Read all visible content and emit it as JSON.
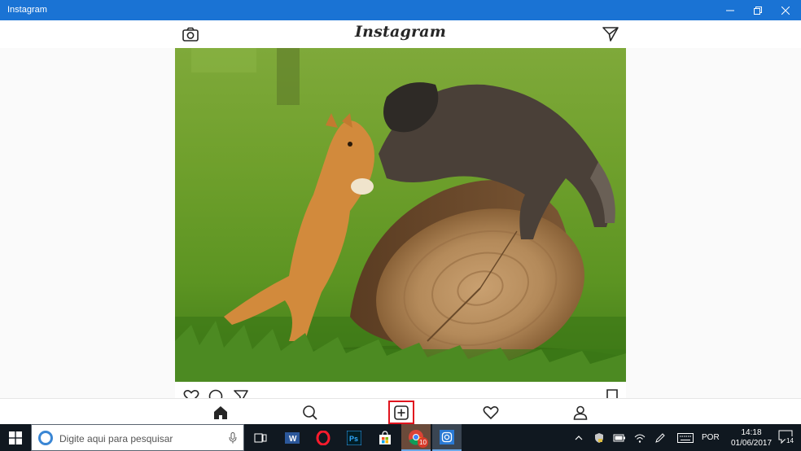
{
  "window": {
    "title": "Instagram"
  },
  "app": {
    "logo": "Instagram",
    "accent": "#1a73d4",
    "highlight": "#e0141e"
  },
  "post": {
    "photo_description_icon": "photo-kitten-raccoon-log"
  },
  "bottom_nav": {
    "items": [
      "home-icon",
      "search-icon",
      "new-post-icon",
      "heart-icon",
      "profile-icon"
    ],
    "selected": "home-icon"
  },
  "taskbar": {
    "search_placeholder": "Digite aqui para pesquisar",
    "apps": [
      "task-view-icon",
      "word-icon",
      "opera-icon",
      "photoshop-icon",
      "store-icon",
      "chrome-icon",
      "instagram-icon"
    ],
    "chrome_badge": "10",
    "language": "POR",
    "time": "14:18",
    "date": "01/06/2017",
    "notification_count": "14"
  }
}
